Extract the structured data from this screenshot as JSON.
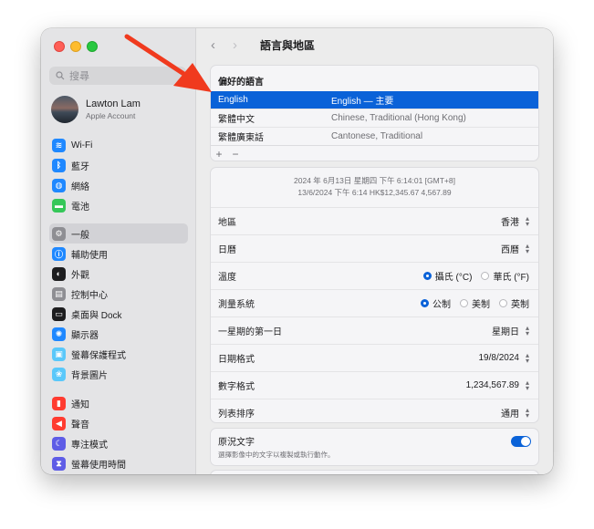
{
  "window": {
    "title": "語言與地區"
  },
  "sidebar": {
    "search_placeholder": "搜尋",
    "account": {
      "name": "Lawton Lam",
      "subtitle": "Apple Account"
    },
    "groups": [
      [
        {
          "label": "Wi-Fi",
          "icon": "wifi-icon",
          "color": "#1f88ff"
        },
        {
          "label": "藍牙",
          "icon": "bluetooth-icon",
          "color": "#1f88ff"
        },
        {
          "label": "網絡",
          "icon": "globe-icon",
          "color": "#1f88ff"
        },
        {
          "label": "電池",
          "icon": "battery-icon",
          "color": "#35c759"
        }
      ],
      [
        {
          "label": "一般",
          "icon": "gear-icon",
          "color": "#8e8e93",
          "selected": true
        },
        {
          "label": "輔助使用",
          "icon": "accessibility-icon",
          "color": "#1f88ff"
        },
        {
          "label": "外觀",
          "icon": "appearance-icon",
          "color": "#1d1d1f"
        },
        {
          "label": "控制中心",
          "icon": "control-center-icon",
          "color": "#8e8e93"
        },
        {
          "label": "桌面與 Dock",
          "icon": "dock-icon",
          "color": "#1d1d1f"
        },
        {
          "label": "顯示器",
          "icon": "display-icon",
          "color": "#1f88ff"
        },
        {
          "label": "螢幕保護程式",
          "icon": "screensaver-icon",
          "color": "#5ac8fa"
        },
        {
          "label": "背景圖片",
          "icon": "wallpaper-icon",
          "color": "#5ac8fa"
        }
      ],
      [
        {
          "label": "通知",
          "icon": "notification-icon",
          "color": "#ff3b30"
        },
        {
          "label": "聲音",
          "icon": "sound-icon",
          "color": "#ff3b30"
        },
        {
          "label": "專注模式",
          "icon": "focus-icon",
          "color": "#5e5ce6"
        },
        {
          "label": "螢幕使用時間",
          "icon": "screen-time-icon",
          "color": "#5e5ce6"
        }
      ]
    ]
  },
  "main": {
    "preferred_languages": {
      "title": "偏好的語言",
      "languages": [
        {
          "name": "English",
          "desc": "English — 主要",
          "selected": true
        },
        {
          "name": "繁體中文",
          "desc": "Chinese, Traditional (Hong Kong)"
        },
        {
          "name": "繁體廣東話",
          "desc": "Cantonese, Traditional"
        }
      ],
      "add_label": "+",
      "remove_label": "−"
    },
    "preview": {
      "line1": "2024 年 6月13日 星期四 下午 6:14:01 [GMT+8]",
      "line2": "13/6/2024 下午 6:14     HK$12,345.67     4,567.89"
    },
    "settings": [
      {
        "label": "地區",
        "value": "香港"
      },
      {
        "label": "日曆",
        "value": "西曆"
      },
      {
        "label": "溫度",
        "radios": [
          {
            "label": "攝氏 (°C)",
            "on": true
          },
          {
            "label": "華氏 (°F)",
            "on": false
          }
        ]
      },
      {
        "label": "測量系統",
        "radios": [
          {
            "label": "公制",
            "on": true
          },
          {
            "label": "美制",
            "on": false
          },
          {
            "label": "英制",
            "on": false
          }
        ]
      },
      {
        "label": "一星期的第一日",
        "value": "星期日"
      },
      {
        "label": "日期格式",
        "value": "19/8/2024"
      },
      {
        "label": "數字格式",
        "value": "1,234,567.89"
      },
      {
        "label": "列表排序",
        "value": "通用"
      }
    ],
    "live_text": {
      "title": "原況文字",
      "subtitle": "選擇影像中的文字以複製或執行動作。",
      "enabled": true
    }
  },
  "colors": {
    "accent": "#0a62d8",
    "arrow": "#f03a1e"
  }
}
